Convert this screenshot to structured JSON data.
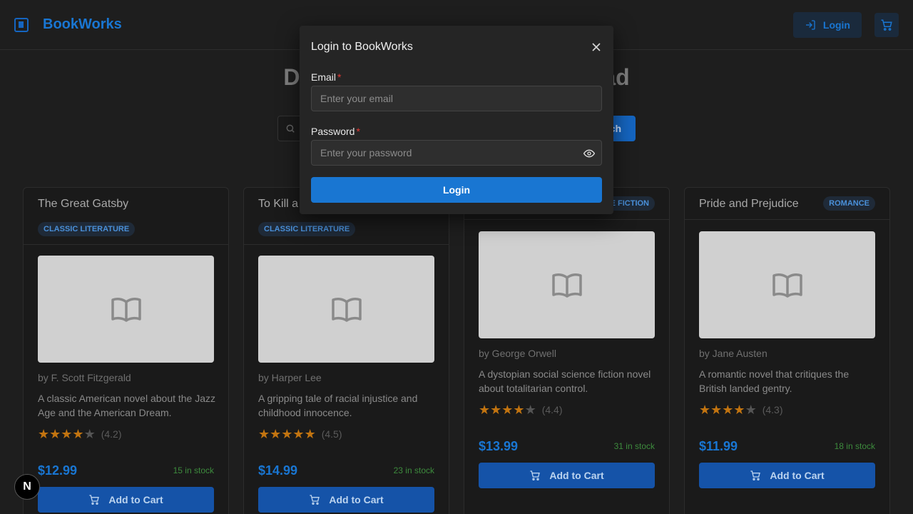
{
  "brand": {
    "name": "BookWorks"
  },
  "header": {
    "login_label": "Login"
  },
  "hero": {
    "title_left": "Di",
    "title_right": "ad",
    "search_button_fragment": "ch"
  },
  "modal": {
    "title": "Login to BookWorks",
    "email_label": "Email",
    "email_placeholder": "Enter your email",
    "password_label": "Password",
    "password_placeholder": "Enter your password",
    "required_mark": "*",
    "submit_label": "Login"
  },
  "books": [
    {
      "title": "The Great Gatsby",
      "category": "CLASSIC LITERATURE",
      "author": "by F. Scott Fitzgerald",
      "description": "A classic American novel about the Jazz Age and the American Dream.",
      "rating": 4.2,
      "rating_text": "(4.2)",
      "stars_filled": 4,
      "price": "$12.99",
      "stock": "15 in stock",
      "cart_label": "Add to Cart"
    },
    {
      "title": "To Kill a",
      "category": "CLASSIC LITERATURE",
      "author": "by Harper Lee",
      "description": "A gripping tale of racial injustice and childhood innocence.",
      "rating": 4.5,
      "rating_text": "(4.5)",
      "stars_filled": 5,
      "price": "$14.99",
      "stock": "23 in stock",
      "cart_label": "Add to Cart"
    },
    {
      "title": "",
      "category": "E FICTION",
      "author": "by George Orwell",
      "description": "A dystopian social science fiction novel about totalitarian control.",
      "rating": 4.4,
      "rating_text": "(4.4)",
      "stars_filled": 4,
      "price": "$13.99",
      "stock": "31 in stock",
      "cart_label": "Add to Cart"
    },
    {
      "title": "Pride and Prejudice",
      "category": "ROMANCE",
      "author": "by Jane Austen",
      "description": "A romantic novel that critiques the British landed gentry.",
      "rating": 4.3,
      "rating_text": "(4.3)",
      "stars_filled": 4,
      "price": "$11.99",
      "stock": "18 in stock",
      "cart_label": "Add to Cart"
    }
  ],
  "dev_badge": {
    "label": "N"
  },
  "colors": {
    "accent": "#1976d2",
    "star": "#c27410",
    "stock": "#3d8b3d",
    "required": "#e53935"
  }
}
